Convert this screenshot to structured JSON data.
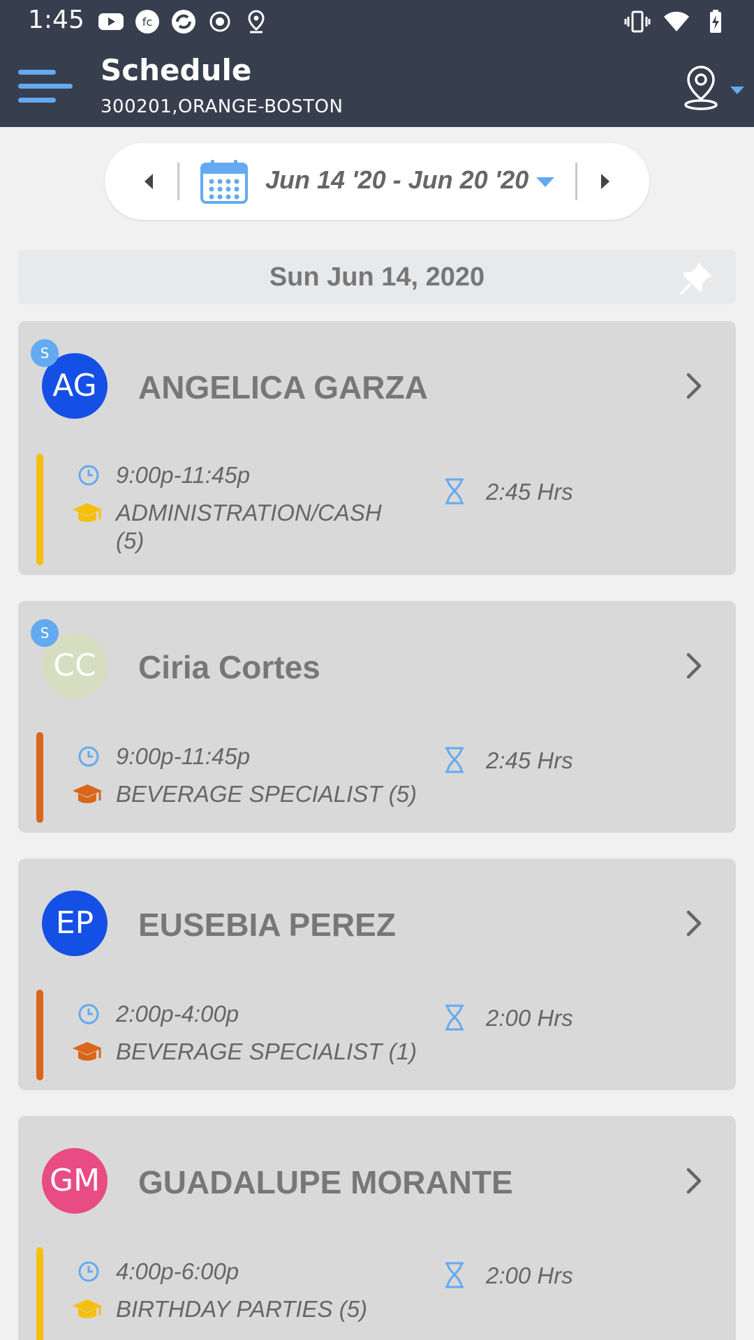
{
  "status_bar": {
    "time": "1:45",
    "left_icons": [
      "youtube-icon",
      "fc-icon",
      "sync-icon",
      "record-icon",
      "location-pin-icon"
    ],
    "right_icons": [
      "vibrate-icon",
      "wifi-icon",
      "battery-charging-icon"
    ]
  },
  "app_bar": {
    "title": "Schedule",
    "subtitle": "300201,ORANGE-BOSTON"
  },
  "date_picker": {
    "range": "Jun 14 '20 - Jun 20 '20"
  },
  "day": {
    "title": "Sun Jun 14, 2020"
  },
  "colors": {
    "header_bg": "#373f4e",
    "accent_blue": "#64aaf0",
    "yellow": "#f6bf0e",
    "orange": "#d9661a"
  },
  "shifts": [
    {
      "initials": "AG",
      "badge": "S",
      "name": "ANGELICA GARZA",
      "avatar_color": "#1450e6",
      "time": "9:00p-11:45p",
      "role_line1": "ADMINISTRATION/CASH",
      "role_line2": "(5)",
      "hours": "2:45 Hrs",
      "accent": "#f6bf0e"
    },
    {
      "initials": "CC",
      "badge": "S",
      "name": "Ciria Cortes",
      "avatar_color": "#d6ddc0",
      "time": "9:00p-11:45p",
      "role_line1": "BEVERAGE SPECIALIST (5)",
      "hours": "2:45 Hrs",
      "accent": "#d9661a"
    },
    {
      "initials": "EP",
      "name": "EUSEBIA PEREZ",
      "avatar_color": "#1450e6",
      "time": "2:00p-4:00p",
      "role_line1": "BEVERAGE SPECIALIST (1)",
      "hours": "2:00 Hrs",
      "accent": "#d9661a"
    },
    {
      "initials": "GM",
      "name": "GUADALUPE MORANTE",
      "avatar_color": "#e84c82",
      "time": "4:00p-6:00p",
      "role_line1": "BIRTHDAY PARTIES (5)",
      "hours": "2:00 Hrs",
      "accent": "#f6bf0e"
    }
  ]
}
